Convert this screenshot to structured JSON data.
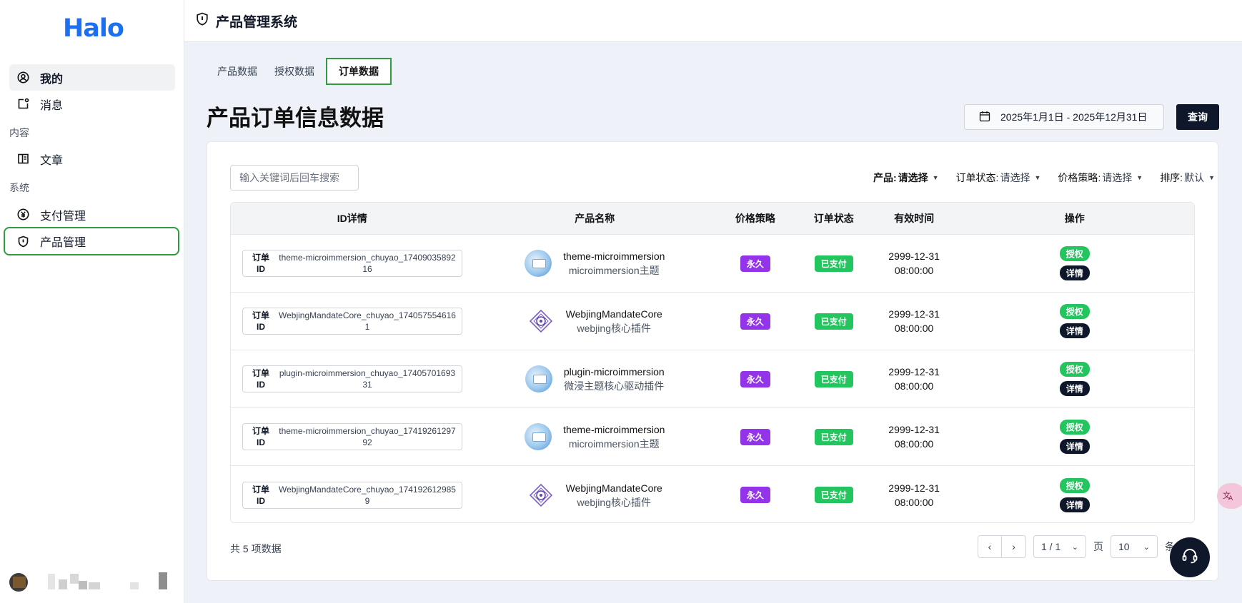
{
  "app": {
    "logo": "Halo",
    "title": "产品管理系统"
  },
  "sidebar": {
    "items": [
      {
        "label": "我的",
        "icon": "user-circle-icon"
      },
      {
        "label": "消息",
        "icon": "message-icon"
      }
    ],
    "group_content": "内容",
    "content_items": [
      {
        "label": "文章",
        "icon": "book-icon"
      }
    ],
    "group_system": "系统",
    "system_items": [
      {
        "label": "支付管理",
        "icon": "yen-coin-icon"
      },
      {
        "label": "产品管理",
        "icon": "shield-icon"
      }
    ]
  },
  "tabs": [
    {
      "label": "产品数据"
    },
    {
      "label": "授权数据"
    },
    {
      "label": "订单数据",
      "active": true
    }
  ],
  "page_title": "产品订单信息数据",
  "date_range": "2025年1月1日 - 2025年12月31日",
  "query_label": "查询",
  "search": {
    "placeholder": "输入关键词后回车搜索"
  },
  "filters": [
    {
      "label": "产品:",
      "value": "请选择"
    },
    {
      "label": "订单状态:",
      "value": "请选择"
    },
    {
      "label": "价格策略:",
      "value": "请选择"
    },
    {
      "label": "排序:",
      "value": "默认"
    }
  ],
  "table": {
    "headers": [
      "ID详情",
      "产品名称",
      "价格策略",
      "订单状态",
      "有效时间",
      "操作"
    ],
    "id_label": "订单ID",
    "rows": [
      {
        "id": "theme-microimmersion_chuyao_1740903589216",
        "name": "theme-microimmersion",
        "desc": "microimmersion主题",
        "pic": "blue",
        "strategy": "永久",
        "status": "已支付",
        "date": "2999-12-31",
        "time": "08:00:00",
        "op1": "授权",
        "op2": "详情"
      },
      {
        "id": "WebjingMandateCore_chuyao_1740575546161",
        "name": "WebjingMandateCore",
        "desc": "webjing核心插件",
        "pic": "dia",
        "strategy": "永久",
        "status": "已支付",
        "date": "2999-12-31",
        "time": "08:00:00",
        "op1": "授权",
        "op2": "详情"
      },
      {
        "id": "plugin-microimmersion_chuyao_1740570169331",
        "name": "plugin-microimmersion",
        "desc": "微浸主题核心驱动插件",
        "pic": "blue",
        "strategy": "永久",
        "status": "已支付",
        "date": "2999-12-31",
        "time": "08:00:00",
        "op1": "授权",
        "op2": "详情"
      },
      {
        "id": "theme-microimmersion_chuyao_1741926129792",
        "name": "theme-microimmersion",
        "desc": "microimmersion主题",
        "pic": "blue",
        "strategy": "永久",
        "status": "已支付",
        "date": "2999-12-31",
        "time": "08:00:00",
        "op1": "授权",
        "op2": "详情"
      },
      {
        "id": "WebjingMandateCore_chuyao_1741926129859",
        "name": "WebjingMandateCore",
        "desc": "webjing核心插件",
        "pic": "dia",
        "strategy": "永久",
        "status": "已支付",
        "date": "2999-12-31",
        "time": "08:00:00",
        "op1": "授权",
        "op2": "详情"
      }
    ]
  },
  "footer": {
    "total": "共 5 项数据",
    "page": "1 / 1",
    "page_unit": "页",
    "size": "10",
    "size_unit": "条"
  },
  "colors": {
    "accent": "#1d6ff2",
    "highlight": "#2e9c3f",
    "purple": "#9333ea",
    "green": "#22c55e",
    "dark": "#0f172a"
  }
}
